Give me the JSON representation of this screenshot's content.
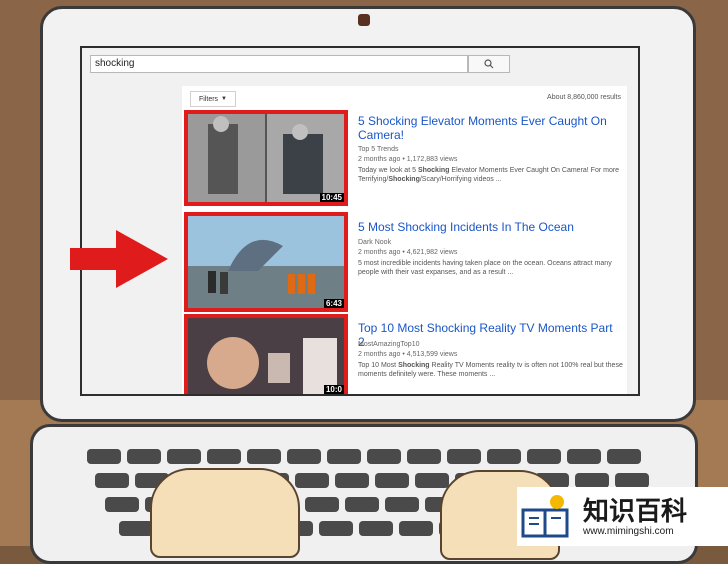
{
  "search": {
    "query": "shocking"
  },
  "results_bar": {
    "filters_label": "Filters",
    "count_text": "About 8,860,000 results"
  },
  "videos": [
    {
      "title": "5 Shocking Elevator Moments Ever Caught On Camera!",
      "channel": "Top 5 Trends",
      "meta": "2 months ago • 1,172,883 views",
      "desc_before": "Today we look at 5 ",
      "desc_bold": "Shocking",
      "desc_after": " Elevator Moments Ever Caught On Camera! For more Terrifying/",
      "desc_bold2": "Shocking",
      "desc_after2": "/Scary/Horrifying videos ...",
      "duration": "10:45"
    },
    {
      "title": "5 Most Shocking Incidents In The Ocean",
      "channel": "Dark Nook",
      "meta": "2 months ago • 4,621,982 views",
      "desc": "5 most incredible incidents having taken place on the ocean. Oceans attract many people with their vast expanses, and as a result ...",
      "duration": "6:43"
    },
    {
      "title": "Top 10 Most Shocking Reality TV Moments Part 2",
      "channel": "MostAmazingTop10",
      "meta": "2 months ago • 4,513,599 views",
      "desc_before": "Top 10 Most ",
      "desc_bold": "Shocking",
      "desc_after": " Reality TV Moments reality tv is often not 100% real but these moments definitely were. These moments ...",
      "duration": "10:0"
    }
  ],
  "watermark": {
    "text": "知识百科",
    "url": "www.mimingshi.com"
  },
  "colors": {
    "highlight": "#e01b1b",
    "link": "#1a56c8"
  }
}
